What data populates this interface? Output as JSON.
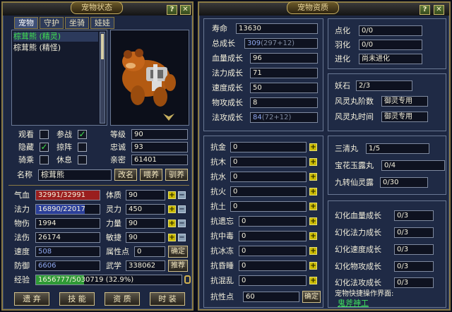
{
  "left_panel": {
    "title": "宠物状态",
    "help_label": "?",
    "close_label": "✕",
    "tabs": [
      "宠物",
      "守护",
      "坐骑",
      "娃娃"
    ],
    "pet_list": [
      "棕茸熊 (精灵)",
      "棕茸熊 (精怪)"
    ],
    "checks": {
      "guan_kan": {
        "label": "观看",
        "checked": false
      },
      "can_zhan": {
        "label": "参战",
        "checked": true
      },
      "yin_cang": {
        "label": "隐藏",
        "checked": true
      },
      "lue_zhen": {
        "label": "掠阵",
        "checked": false
      },
      "qi_cheng": {
        "label": "骑乘",
        "checked": false
      },
      "xiu_xi": {
        "label": "休息",
        "checked": false
      }
    },
    "info": {
      "level_label": "等级",
      "level_value": "90",
      "loyalty_label": "忠诚",
      "loyalty_value": "93",
      "intimacy_label": "亲密",
      "intimacy_value": "61401"
    },
    "name_label": "名称",
    "name_value": "棕茸熊",
    "rename_btn": "改名",
    "feed_btn": "喂养",
    "tame_btn": "驯养",
    "stats": {
      "hp_label": "气血",
      "hp_value": "32991/32991",
      "mp_label": "法力",
      "mp_value": "16890/22017",
      "patk_label": "物伤",
      "patk_value": "1994",
      "matk_label": "法伤",
      "matk_value": "26174",
      "speed_label": "速度",
      "speed_value": "508",
      "def_label": "防御",
      "def_value": "6606",
      "exp_label": "经验",
      "exp_value": "1656777/5030719 (32.9%)",
      "exp_fraction": 0.329,
      "con_label": "体质",
      "con_value": "90",
      "spi_label": "灵力",
      "spi_value": "450",
      "str_label": "力量",
      "str_value": "90",
      "agi_label": "敏捷",
      "agi_value": "90",
      "pts_label": "属性点",
      "pts_value": "0",
      "confirm_btn": "确定",
      "wuxue_label": "武学",
      "wuxue_value": "338062",
      "recommend_btn": "推荐"
    },
    "bottom_btns": [
      "遗 弃",
      "技 能",
      "资 质",
      "时 装"
    ]
  },
  "right_panel": {
    "title": "宠物资质",
    "help_label": "?",
    "close_label": "✕",
    "aptitude": [
      {
        "label": "寿命",
        "value": "13630",
        "extra": ""
      },
      {
        "label": "总成长",
        "value": "309",
        "extra": "(297+12)"
      },
      {
        "label": "血量成长",
        "value": "96",
        "extra": ""
      },
      {
        "label": "法力成长",
        "value": "71",
        "extra": ""
      },
      {
        "label": "速度成长",
        "value": "50",
        "extra": ""
      },
      {
        "label": "物攻成长",
        "value": "8",
        "extra": ""
      },
      {
        "label": "法攻成长",
        "value": "84",
        "extra": "(72+12)"
      }
    ],
    "awaken": [
      {
        "label": "点化",
        "value": "0/0"
      },
      {
        "label": "羽化",
        "value": "0/0"
      },
      {
        "label": "进化",
        "value": "尚未进化"
      }
    ],
    "yao_shi": [
      {
        "label": "妖石",
        "value": "2/3"
      },
      {
        "label": "风灵丸阶数",
        "value": "御灵专用"
      },
      {
        "label": "风灵丸时间",
        "value": "御灵专用"
      }
    ],
    "resist": [
      {
        "label": "抗金",
        "value": "0"
      },
      {
        "label": "抗木",
        "value": "0"
      },
      {
        "label": "抗水",
        "value": "0"
      },
      {
        "label": "抗火",
        "value": "0"
      },
      {
        "label": "抗土",
        "value": "0"
      },
      {
        "label": "抗遗忘",
        "value": "0"
      },
      {
        "label": "抗中毒",
        "value": "0"
      },
      {
        "label": "抗冰冻",
        "value": "0"
      },
      {
        "label": "抗昏睡",
        "value": "0"
      },
      {
        "label": "抗混乱",
        "value": "0"
      }
    ],
    "resist_pts_label": "抗性点",
    "resist_pts_value": "60",
    "resist_confirm_btn": "确定",
    "items": [
      {
        "label": "三清丸",
        "value": "1/5"
      },
      {
        "label": "宝花玉露丸",
        "value": "0/4"
      },
      {
        "label": "九转仙灵露",
        "value": "0/30"
      }
    ],
    "huanhua": [
      {
        "label": "幻化血量成长",
        "value": "0/3"
      },
      {
        "label": "幻化法力成长",
        "value": "0/3"
      },
      {
        "label": "幻化速度成长",
        "value": "0/3"
      },
      {
        "label": "幻化物攻成长",
        "value": "0/3"
      },
      {
        "label": "幻化法攻成长",
        "value": "0/3"
      }
    ],
    "quick_label": "宠物快捷操作界面:",
    "quick_link": "鬼斧神工"
  },
  "colors": {
    "panel_bg": "#1d2741",
    "gold_border": "#8a7a44",
    "hp_fill": "#9a1e1e",
    "mp_fill": "#2b3f9a",
    "exp_fill": "#2f9a36",
    "link_green": "#3fe060",
    "selected_pet": "#3fe050"
  }
}
